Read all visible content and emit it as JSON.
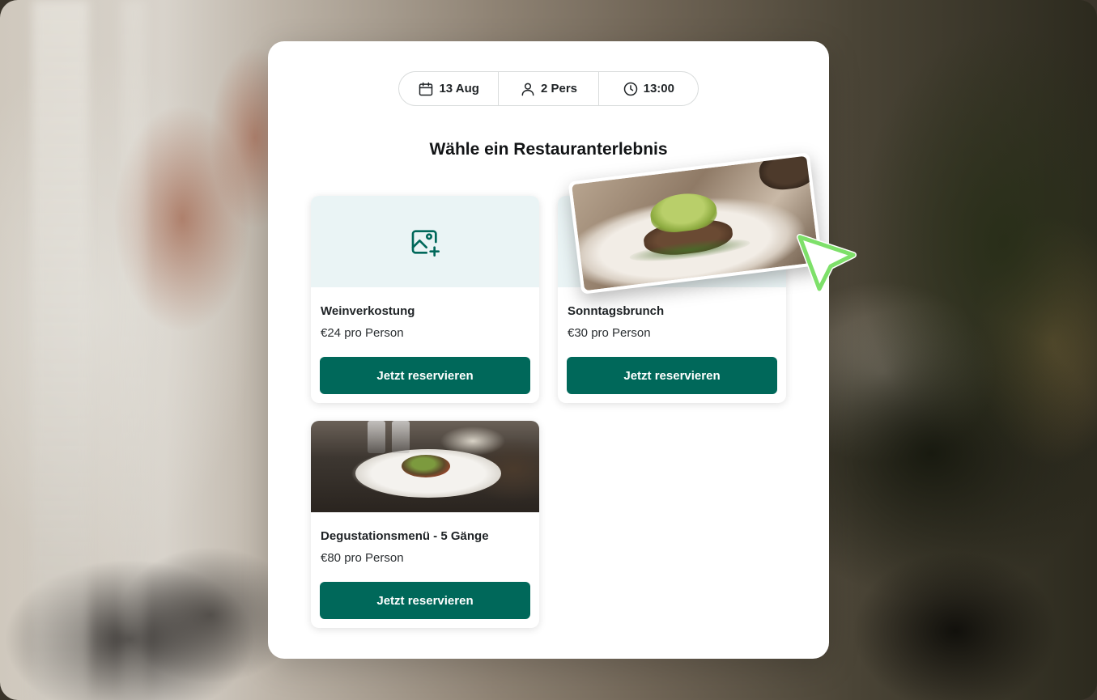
{
  "filters": {
    "date": "13 Aug",
    "party": "2 Pers",
    "time": "13:00"
  },
  "heading": "Wähle ein Restauranterlebnis",
  "experiences": [
    {
      "title": "Weinverkostung",
      "price": "€24 pro Person",
      "button": "Jetzt reservieren",
      "media": "image-add-icon"
    },
    {
      "title": "Sonntagsbrunch",
      "price": "€30 pro Person",
      "button": "Jetzt reservieren",
      "media": "brunch-photo"
    },
    {
      "title": "Degustationsmenü - 5 Gänge",
      "price": "€80 pro Person",
      "button": "Jetzt reservieren",
      "media": "tasting-menu-photo"
    }
  ],
  "colors": {
    "accent": "#00685a",
    "media_placeholder": "#eaf4f5",
    "cursor": "#7ee06a"
  }
}
